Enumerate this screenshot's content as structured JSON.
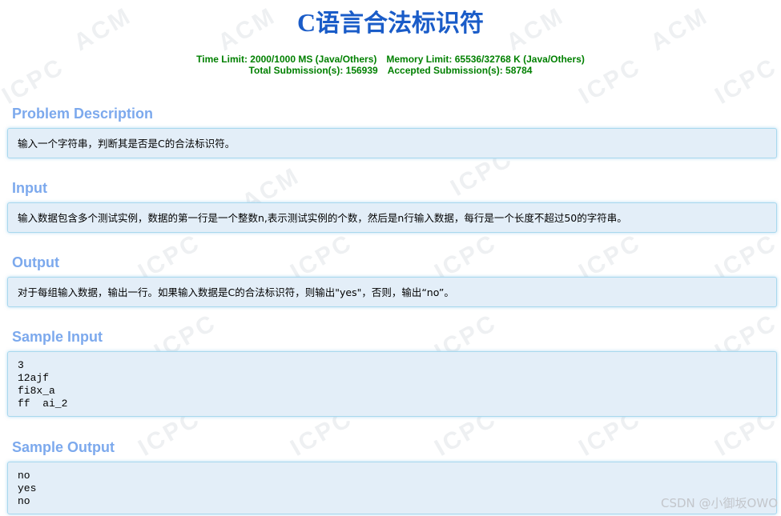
{
  "header": {
    "title_latin": "C",
    "title_cjk": "语言合法标识符",
    "time_limit": "Time Limit: 2000/1000 MS (Java/Others)",
    "memory_limit": "Memory Limit: 65536/32768 K (Java/Others)",
    "total_submissions": "Total Submission(s): 156939",
    "accepted_submissions": "Accepted Submission(s): 58784"
  },
  "sections": {
    "description": {
      "title": "Problem Description",
      "text": "输入一个字符串，判断其是否是C的合法标识符。"
    },
    "input": {
      "title": "Input",
      "text": "输入数据包含多个测试实例，数据的第一行是一个整数n,表示测试实例的个数，然后是n行输入数据，每行是一个长度不超过50的字符串。"
    },
    "output": {
      "title": "Output",
      "text": "对于每组输入数据，输出一行。如果输入数据是C的合法标识符，则输出\"yes\"，否则，输出“no”。"
    },
    "sample_input": {
      "title": "Sample Input",
      "text": "3\n12ajf\nfi8x_a\nff  ai_2"
    },
    "sample_output": {
      "title": "Sample Output",
      "text": "no\nyes\nno"
    }
  },
  "watermark": {
    "text_acm": "ACM",
    "text_icpc": "ICPC",
    "credit": "CSDN @小御坂OWO"
  }
}
